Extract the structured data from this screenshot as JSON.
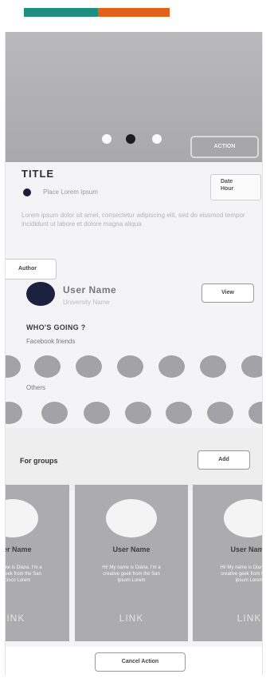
{
  "hero": {
    "action_label": "ACTION",
    "active_slide": 2,
    "slide_count": 3
  },
  "event": {
    "title": "TITLE",
    "place": "Place Lorem Ipsum",
    "date_label": "Date",
    "hour_label": "Hour",
    "description": "Lorem ipsum dolor sit amet, consectetur adipiscing elit, sed do eiusmod tempor incididunt ut labore et dolore magna aliqua"
  },
  "author": {
    "tag": "Author",
    "name": "User Name",
    "university": "University Name",
    "view_label": "View"
  },
  "attendees": {
    "heading": "WHO'S GOING ?",
    "facebook_label": "Facebook friends",
    "others_label": "Others"
  },
  "groups": {
    "label": "For groups",
    "add_label": "Add",
    "cards": [
      {
        "name": "User Name",
        "text": "Hi! My name is Diana. I'm a creative geek from the San Francisco Lorem",
        "link": "LINK"
      },
      {
        "name": "User Name",
        "text": "Hi! My name is Diana. I'm a creative geek from the San Ipsum Lorem",
        "link": "LINK"
      },
      {
        "name": "User Name",
        "text": "Hi! My name is Diana. I'm a creative geek from the San Ipsum Lorem",
        "link": "LINK"
      }
    ]
  },
  "footer": {
    "cancel_label": "Cancel Action"
  },
  "colors": {
    "teal": "#1f8f80",
    "orange": "#e2621c",
    "avatar": "#1c2140"
  }
}
